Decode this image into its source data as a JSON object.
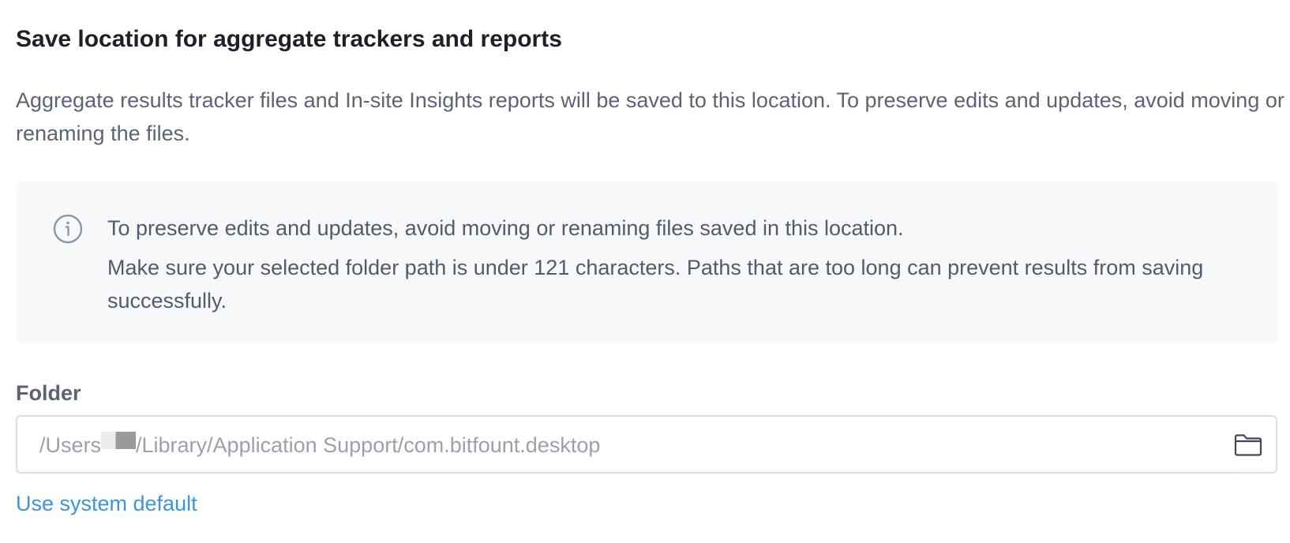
{
  "section": {
    "title": "Save location for aggregate trackers and reports",
    "description": "Aggregate results tracker files and In-site Insights reports will be saved to this location. To preserve edits and updates, avoid moving or renaming the files."
  },
  "info_box": {
    "icon": "info-icon",
    "line1": "To preserve edits and updates, avoid moving or renaming files saved in this location.",
    "line2": "Make sure your selected folder path is under 121 characters. Paths that are too long can prevent results from saving successfully."
  },
  "folder": {
    "label": "Folder",
    "path_prefix": "/Users",
    "path_suffix": "/Library/Application Support/com.bitfount.desktop",
    "browse_icon": "folder-icon"
  },
  "actions": {
    "use_system_default": "Use system default"
  },
  "colors": {
    "link": "#3b94dc",
    "info_background": "#f7f8fa",
    "text_muted": "#5b6474"
  }
}
